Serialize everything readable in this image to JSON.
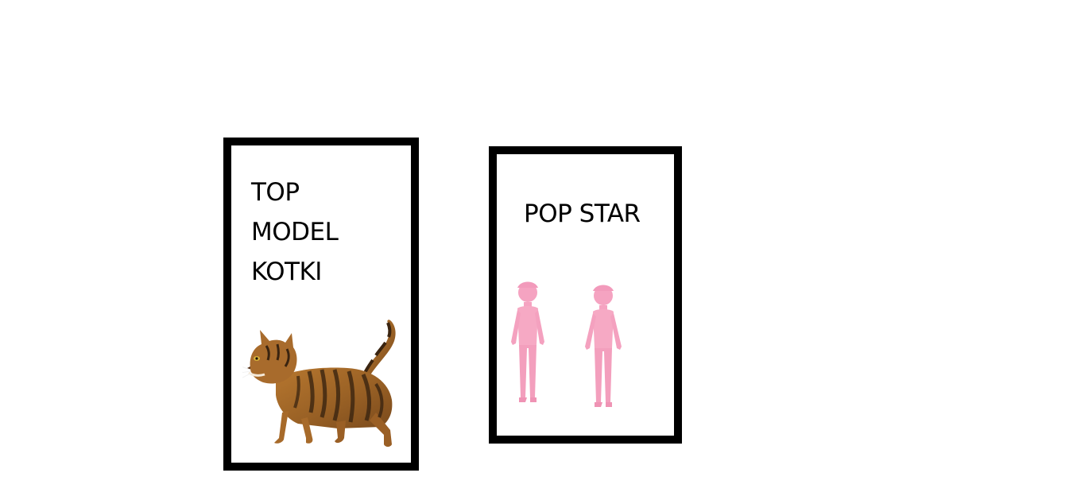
{
  "cards": [
    {
      "title": "TOP\nMODEL\nKOTKI",
      "image": "tabby-cat-walking",
      "border_color": "#000000"
    },
    {
      "title": "POP STAR",
      "images": [
        "pink-figure",
        "pink-figure"
      ],
      "border_color": "#000000"
    }
  ],
  "colors": {
    "background": "#ffffff",
    "border": "#000000",
    "figure_pink": "#f6a9c4"
  }
}
